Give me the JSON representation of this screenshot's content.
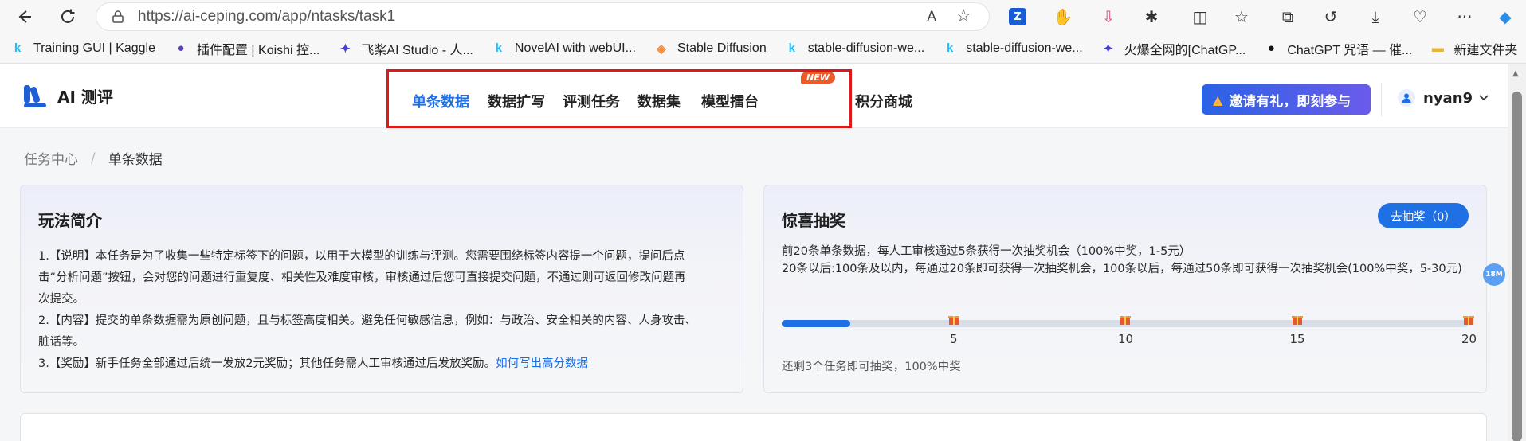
{
  "browser": {
    "url": "https://ai-ceping.com/app/ntasks/task1",
    "bookmarks": [
      {
        "label": "Training GUI | Kaggle",
        "icon": "kaggle-icon",
        "glyph": "k",
        "color": "#20beff"
      },
      {
        "label": "插件配置 | Koishi 控...",
        "icon": "koishi-icon",
        "glyph": "●",
        "color": "#5b3fb8"
      },
      {
        "label": "飞桨AI Studio - 人...",
        "icon": "paddle-icon",
        "glyph": "✦",
        "color": "#4a3fd1"
      },
      {
        "label": "NovelAI with webUI...",
        "icon": "kaggle-icon",
        "glyph": "k",
        "color": "#20beff"
      },
      {
        "label": "Stable Diffusion",
        "icon": "stable-diffusion-icon",
        "glyph": "◈",
        "color": "#f08a3a"
      },
      {
        "label": "stable-diffusion-we...",
        "icon": "kaggle-icon",
        "glyph": "k",
        "color": "#20beff"
      },
      {
        "label": "stable-diffusion-we...",
        "icon": "kaggle-icon",
        "glyph": "k",
        "color": "#20beff"
      },
      {
        "label": "火爆全网的[ChatGP...",
        "icon": "paddle-icon",
        "glyph": "✦",
        "color": "#4a3fd1"
      },
      {
        "label": "ChatGPT 咒语 — 催...",
        "icon": "github-icon",
        "glyph": "●",
        "color": "#111111"
      },
      {
        "label": "新建文件夹",
        "icon": "folder-icon",
        "glyph": "▬",
        "color": "#e8b533"
      }
    ]
  },
  "header": {
    "logo_text": "AI 测评",
    "nav": [
      {
        "label": "单条数据",
        "active": true
      },
      {
        "label": "数据扩写",
        "active": false
      },
      {
        "label": "评测任务",
        "active": false
      },
      {
        "label": "数据集",
        "active": false
      },
      {
        "label": "模型擂台",
        "active": false
      },
      {
        "label": "积分商城",
        "active": false
      }
    ],
    "new_badge": "NEW",
    "invite_label": "邀请有礼，即刻参与",
    "username": "nyan9"
  },
  "breadcrumb": {
    "root": "任务中心",
    "current": "单条数据"
  },
  "intro": {
    "title": "玩法简介",
    "lines": [
      "1.【说明】本任务是为了收集一些特定标签下的问题，以用于大模型的训练与评测。您需要围绕标签内容提一个问题，提问后点",
      "击“分析问题”按钮，会对您的问题进行重复度、相关性及难度审核，审核通过后您可直接提交问题，不通过则可返回修改问题再",
      "次提交。",
      "2.【内容】提交的单条数据需为原创问题，且与标签高度相关。避免任何敏感信息，例如：与政治、安全相关的内容、人身攻击、",
      "脏话等。"
    ],
    "line3_prefix": "3.【奖励】新手任务全部通过后统一发放2元奖励；其他任务需人工审核通过后发放奖励。",
    "line3_link": "如何写出高分数据"
  },
  "lottery": {
    "title": "惊喜抽奖",
    "button_label": "去抽奖（0）",
    "desc_line1": "前20条单条数据，每人工审核通过5条获得一次抽奖机会（100%中奖，1-5元）",
    "desc_line2": "20条以后:100条及以内，每通过20条即可获得一次抽奖机会，100条以后，每通过50条即可获得一次抽奖机会(100%中奖，5-30元)",
    "progress_value": 2,
    "progress_max": 20,
    "milestones": [
      "5",
      "10",
      "15",
      "20"
    ],
    "remain_text": "还剩3个任务即可抽奖，100%中奖"
  },
  "float_badge": "18M",
  "colors": {
    "accent": "#1f6fe5",
    "highlight_border": "#e01818",
    "new_badge": "#ef5a2b"
  }
}
